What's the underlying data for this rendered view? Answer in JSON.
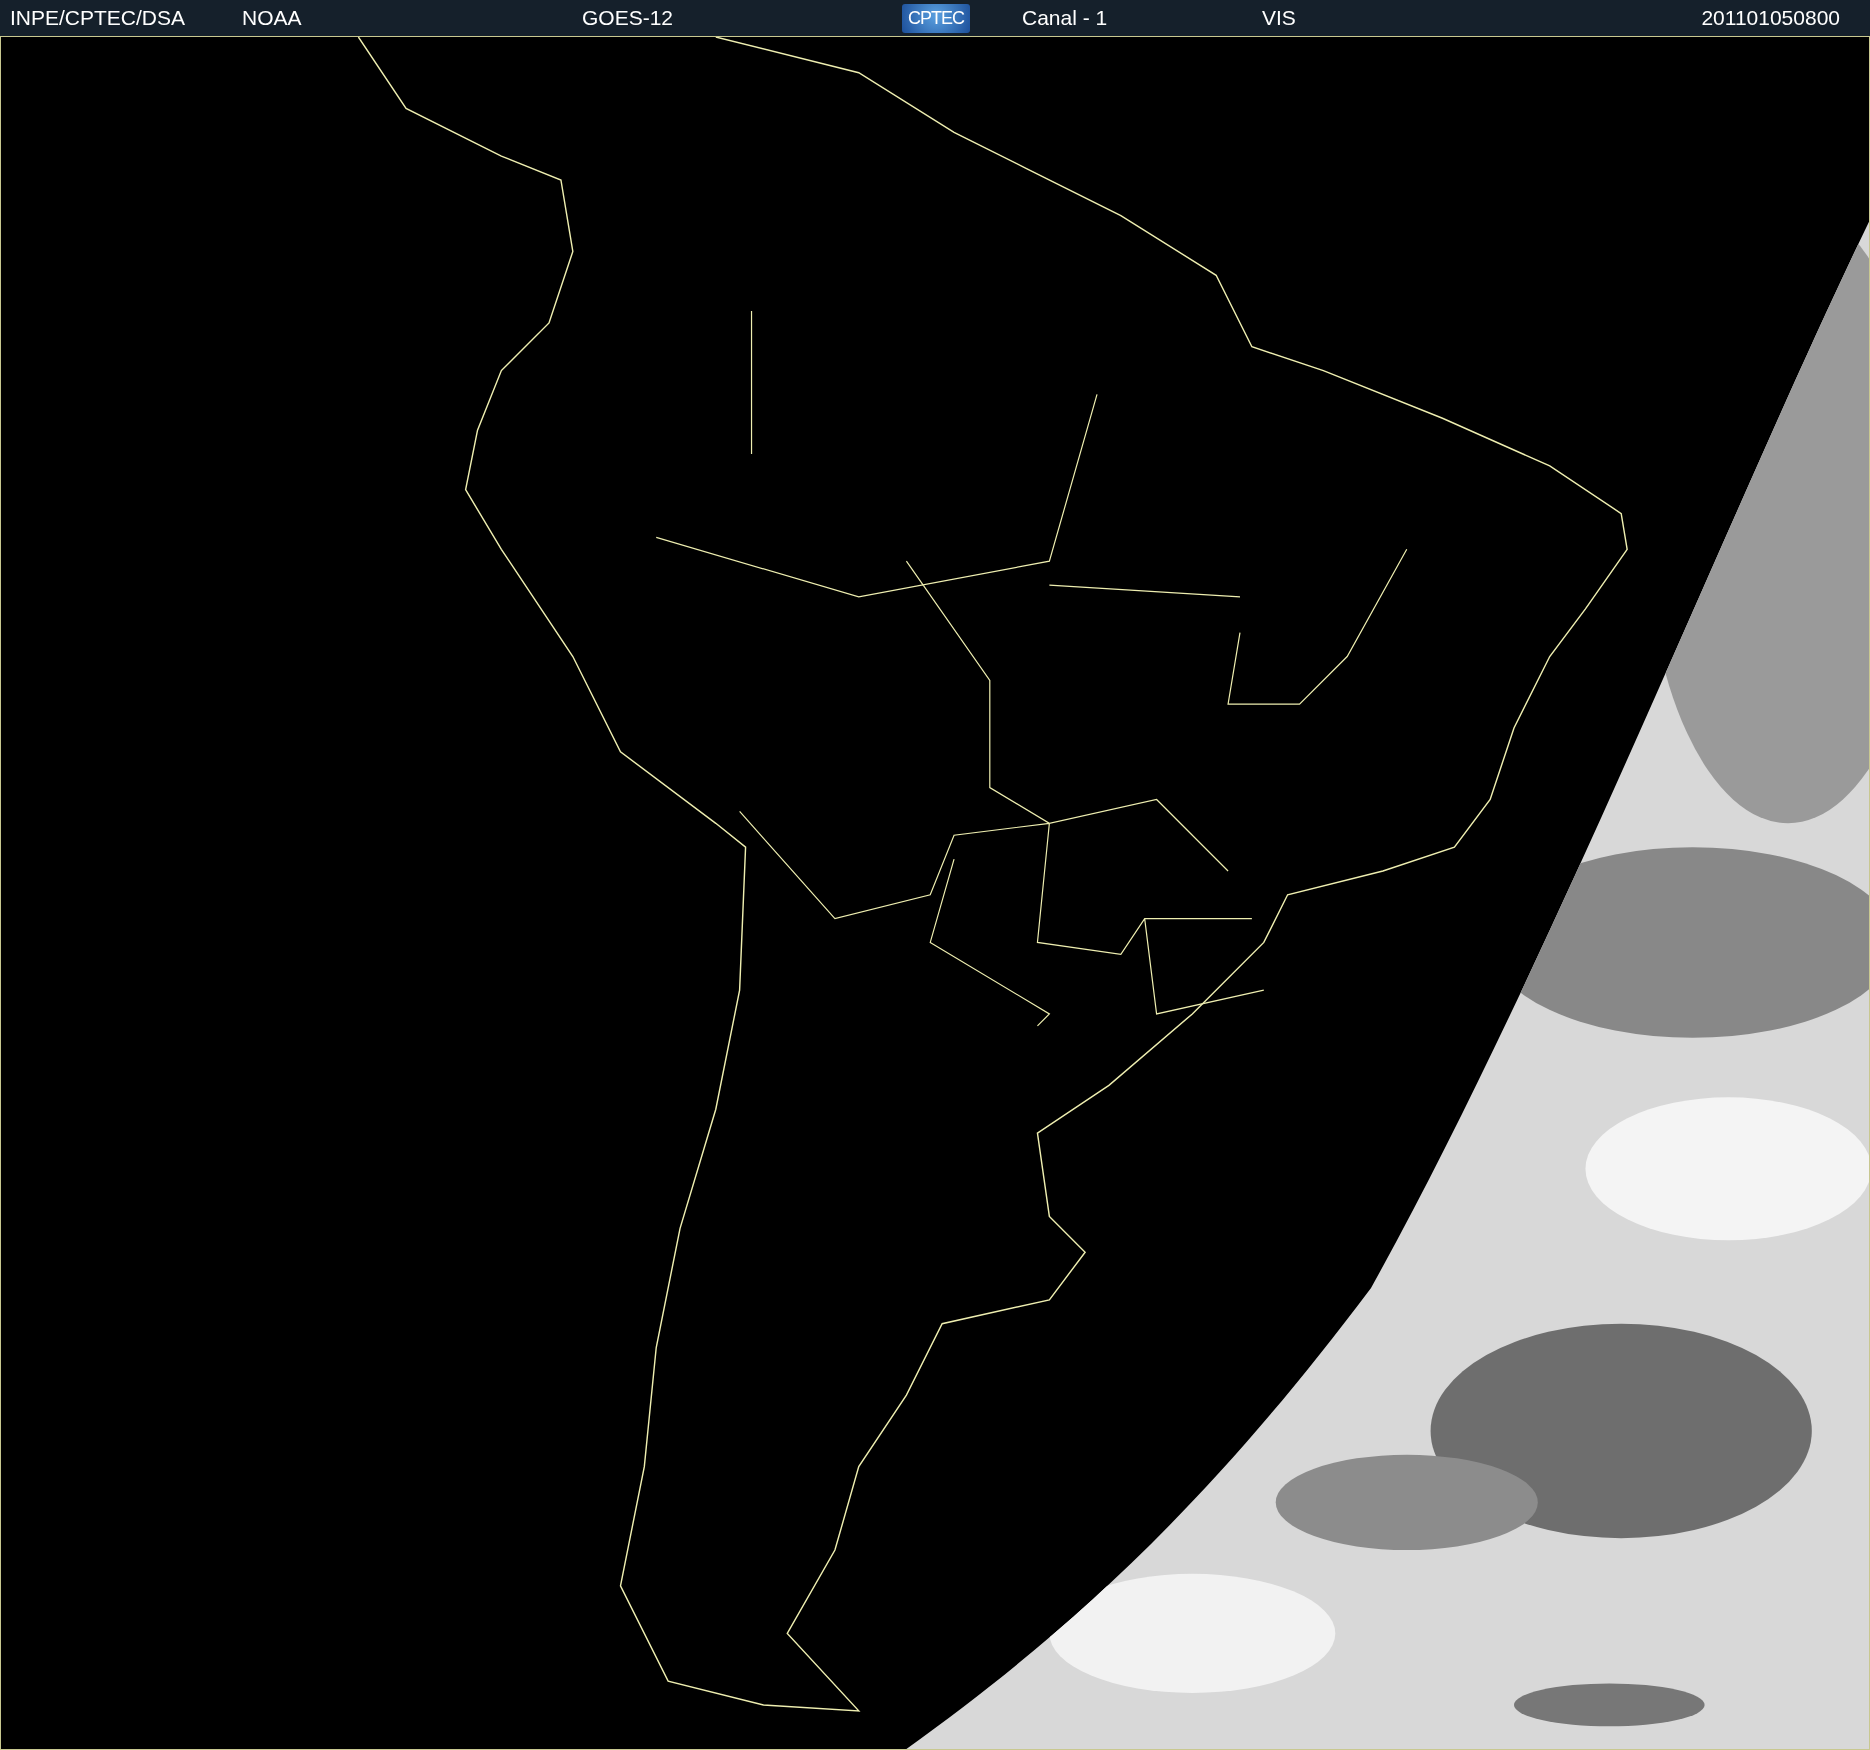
{
  "header": {
    "items": [
      {
        "kind": "text",
        "text": "INPE/CPTEC/DSA"
      },
      {
        "kind": "text",
        "text": "NOAA"
      },
      {
        "kind": "text",
        "text": "GOES-12"
      },
      {
        "kind": "logo",
        "text": "CPTEC"
      },
      {
        "kind": "text",
        "text": "Canal - 1"
      },
      {
        "kind": "text",
        "text": "VIS"
      },
      {
        "kind": "text",
        "text": "201101050800"
      }
    ]
  }
}
